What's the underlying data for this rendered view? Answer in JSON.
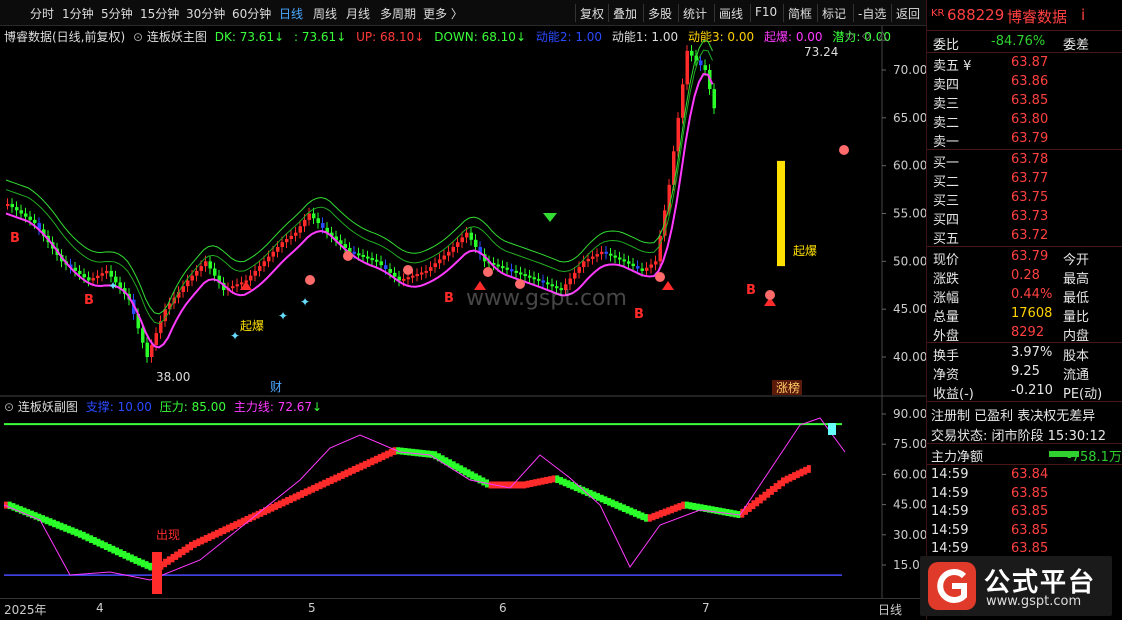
{
  "toolbar": {
    "left_items": [
      "分时",
      "1分钟",
      "5分钟",
      "15分钟",
      "30分钟",
      "60分钟",
      "日线",
      "周线",
      "月线",
      "多周期",
      "更多 〉"
    ],
    "active": "日线",
    "right_items": [
      "复权",
      "叠加",
      "多股",
      "统计",
      "画线",
      "F10",
      "简框",
      "标记",
      "-自选",
      "返回"
    ]
  },
  "main_legend": {
    "stock": "博睿数据(日线,前复权)",
    "indicator": "连板妖主图",
    "dk": "DK: 73.61",
    "colon_val": ": 73.61",
    "up": "UP: 68.10",
    "down": "DOWN: 68.10",
    "dn2": "动能2: 1.00",
    "dn1": "动能1: 1.00",
    "dn3": "动能3: 0.00",
    "qibao": "起爆: 0.00",
    "qianli": "潜力: 0.00"
  },
  "main_axis": [
    "70.00",
    "65.00",
    "60.00",
    "55.00",
    "50.00",
    "45.00",
    "40.00"
  ],
  "annotations": {
    "high": "73.24",
    "low": "38.00",
    "qibao1": "起爆",
    "qibao2": "起爆",
    "cai": "财",
    "zhangbang": "涨榜",
    "chuxian": "出现",
    "watermark": "www.gspt.com"
  },
  "sub_legend": {
    "name": "连板妖副图",
    "zhicheng": "支撑: 10.00",
    "yali": "压力: 85.00",
    "zhulixian": "主力线: 72.67"
  },
  "sub_axis": [
    "90.00",
    "75.00",
    "60.00",
    "45.00",
    "30.00",
    "15.00"
  ],
  "time_axis": [
    "2025年",
    "4",
    "5",
    "6",
    "7",
    "日线"
  ],
  "quote": {
    "market_tag": "KR",
    "code": "688229",
    "name": "博睿数据",
    "info_mark": "i",
    "weibi_label": "委比",
    "weibi_value": "-84.76%",
    "weicha_label": "委差",
    "sells": [
      {
        "label": "卖五 ¥",
        "price": "63.87"
      },
      {
        "label": "卖四",
        "price": "63.86"
      },
      {
        "label": "卖三",
        "price": "63.85"
      },
      {
        "label": "卖二",
        "price": "63.80"
      },
      {
        "label": "卖一",
        "price": "63.79"
      }
    ],
    "buys": [
      {
        "label": "买一",
        "price": "63.78"
      },
      {
        "label": "买二",
        "price": "63.77"
      },
      {
        "label": "买三",
        "price": "63.75"
      },
      {
        "label": "买四",
        "price": "63.73"
      },
      {
        "label": "买五",
        "price": "63.72"
      }
    ],
    "stats": [
      {
        "l1": "现价",
        "v1": "63.79",
        "c1": "red",
        "l2": "今开"
      },
      {
        "l1": "涨跌",
        "v1": "0.28",
        "c1": "red",
        "l2": "最高"
      },
      {
        "l1": "涨幅",
        "v1": "0.44%",
        "c1": "red",
        "l2": "最低"
      },
      {
        "l1": "总量",
        "v1": "17608",
        "c1": "yellow",
        "l2": "量比"
      },
      {
        "l1": "外盘",
        "v1": "8292",
        "c1": "red",
        "l2": "内盘"
      }
    ],
    "stats2": [
      {
        "l1": "换手",
        "v1": "3.97%",
        "l2": "股本"
      },
      {
        "l1": "净资",
        "v1": "9.25",
        "l2": "流通"
      },
      {
        "l1": "收益(-)",
        "v1": "-0.210",
        "l2": "PE(动)"
      }
    ],
    "flags": "注册制 已盈利 表决权无差异",
    "trade_status": "交易状态: 闭市阶段 15:30:12",
    "net_label": "主力净额",
    "net_value": "-758.1万",
    "ticks": [
      {
        "time": "14:59",
        "price": "63.84"
      },
      {
        "time": "14:59",
        "price": "63.85"
      },
      {
        "time": "14:59",
        "price": "63.85"
      },
      {
        "time": "14:59",
        "price": "63.85"
      },
      {
        "time": "14:59",
        "price": "63.85"
      }
    ]
  },
  "logo": {
    "text": "公式平台",
    "url": "www.gspt.com"
  },
  "colors": {
    "up": "#ff2a2a",
    "down": "#2aff2a",
    "blue": "#2a4aff",
    "magenta": "#ff3aff",
    "yellow": "#ffe000",
    "line_green": "#3aff3a"
  }
}
